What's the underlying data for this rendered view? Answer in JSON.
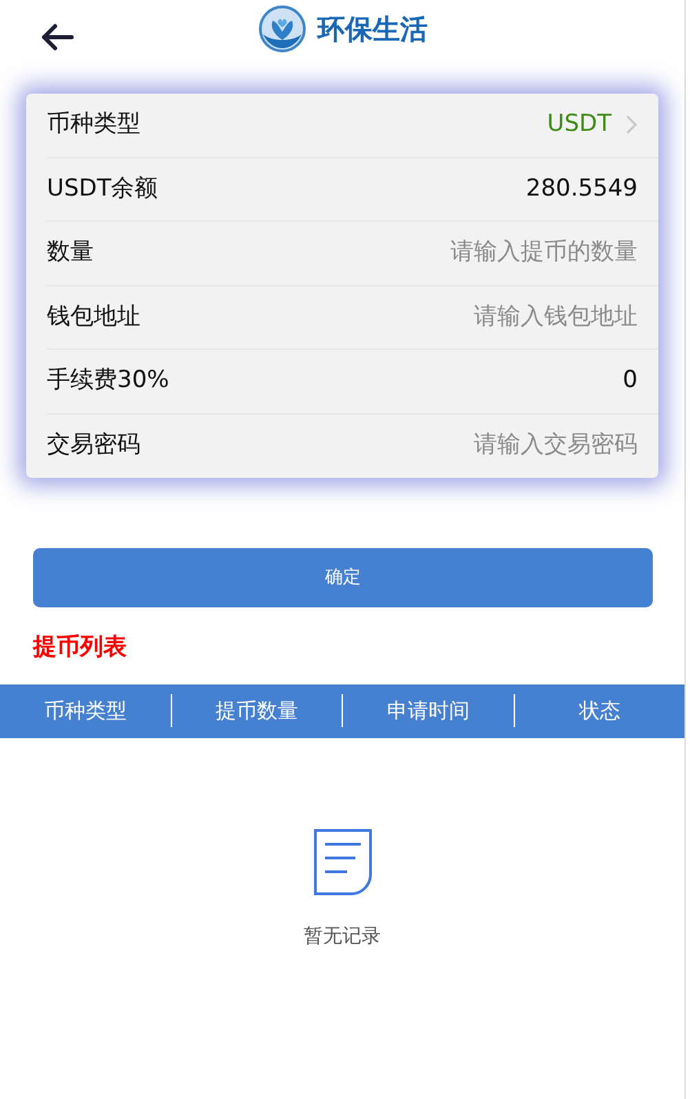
{
  "header": {
    "title": "环保生活"
  },
  "form": [
    {
      "kind": "select",
      "label": "币种类型",
      "value": "USDT"
    },
    {
      "kind": "text",
      "label": "USDT余额",
      "value": "280.5549"
    },
    {
      "kind": "input",
      "label": "数量",
      "placeholder": "请输入提币的数量"
    },
    {
      "kind": "input",
      "label": "钱包地址",
      "placeholder": "请输入钱包地址"
    },
    {
      "kind": "text",
      "label": "手续费30%",
      "value": "0"
    },
    {
      "kind": "input",
      "label": "交易密码",
      "placeholder": "请输入交易密码"
    }
  ],
  "submit_button": "确定",
  "list_title": "提币列表",
  "table": {
    "columns": [
      "币种类型",
      "提币数量",
      "申请时间",
      "状态"
    ]
  },
  "empty_state": "暂无记录"
}
